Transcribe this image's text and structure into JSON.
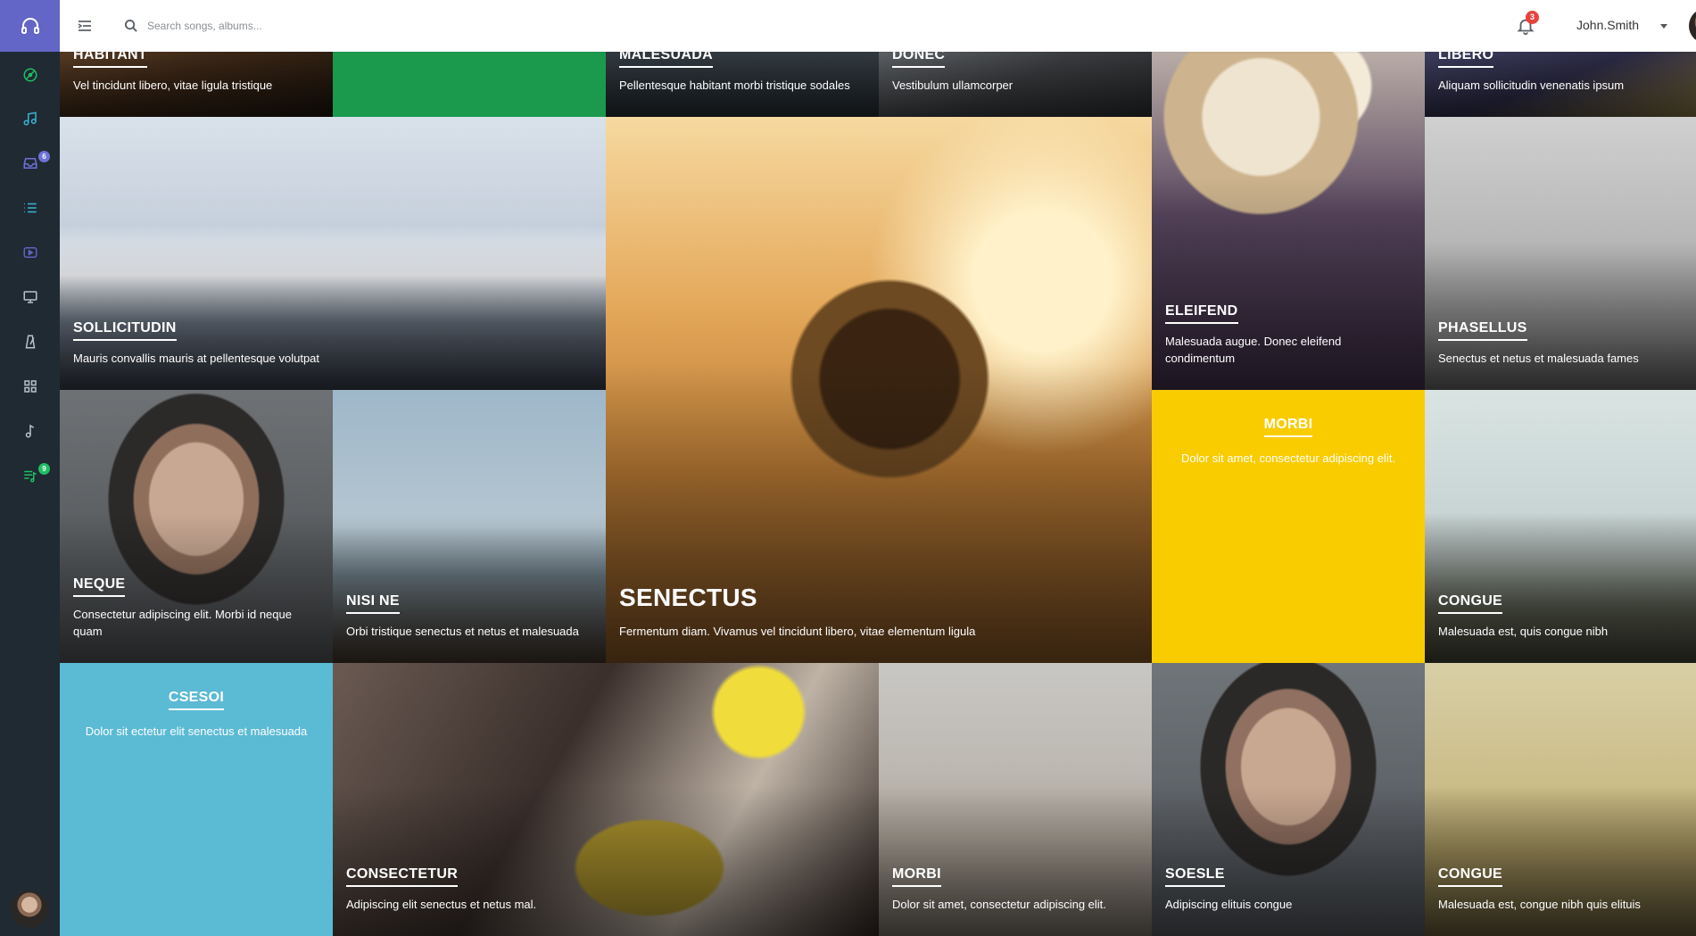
{
  "header": {
    "search_placeholder": "Search songs, albums...",
    "notifications_count": "3",
    "user_name": "John.Smith"
  },
  "sidebar": {
    "items": [
      {
        "icon": "headphones-icon"
      },
      {
        "icon": "disc-icon",
        "color": "#1fbf63"
      },
      {
        "icon": "music-note-icon",
        "color": "#39b4d8"
      },
      {
        "icon": "inbox-icon",
        "color": "#6e72d8",
        "badge": "6"
      },
      {
        "icon": "list-icon",
        "color": "#39b4d8"
      },
      {
        "icon": "video-icon",
        "color": "#5f63c2"
      },
      {
        "icon": "monitor-icon",
        "color": "#b8c2cc"
      },
      {
        "icon": "metronome-icon",
        "color": "#b8c2cc"
      },
      {
        "icon": "grid-icon",
        "color": "#b8c2cc"
      },
      {
        "icon": "eighth-note-icon",
        "color": "#b8c2cc"
      },
      {
        "icon": "playlist-icon",
        "color": "#1fbf63",
        "badge": "9"
      }
    ]
  },
  "tiles": {
    "habitant": {
      "title": "HABITANT",
      "desc": "Vel tincidunt libero, vitae ligula tristique"
    },
    "malesuada": {
      "title": "MALESUADA",
      "desc": "Pellentesque habitant morbi tristique sodales"
    },
    "donec": {
      "title": "DONEC",
      "desc": "Vestibulum ullamcorper"
    },
    "libero": {
      "title": "LIBERO",
      "desc": "Aliquam sollicitudin venenatis ipsum"
    },
    "sollicitudin": {
      "title": "SOLLICITUDIN",
      "desc": "Mauris convallis mauris at pellentesque volutpat"
    },
    "senectus": {
      "title": "SENECTUS",
      "desc": "Fermentum diam. Vivamus vel tincidunt libero, vitae elementum ligula"
    },
    "eleifend": {
      "title": "ELEIFEND",
      "desc": "Malesuada augue. Donec eleifend condimentum"
    },
    "phasellus": {
      "title": "PHASELLUS",
      "desc": "Senectus et netus et malesuada fames"
    },
    "neque": {
      "title": "NEQUE",
      "desc": "Consectetur adipiscing elit. Morbi id neque quam"
    },
    "nisi_ne": {
      "title": "NISI NE",
      "desc": "Orbi tristique senectus et netus et malesuada"
    },
    "morbi_yellow": {
      "title": "MORBI",
      "desc": "Dolor sit amet, consectetur adipiscing elit."
    },
    "congue_1": {
      "title": "CONGUE",
      "desc": "Malesuada est, quis congue nibh"
    },
    "csesoi": {
      "title": "CSESOI",
      "desc": "Dolor sit ectetur elit senectus et malesuada"
    },
    "consectetur": {
      "title": "CONSECTETUR",
      "desc": "Adipiscing elit senectus et netus mal."
    },
    "morbi_dunes": {
      "title": "MORBI",
      "desc": "Dolor sit amet, consectetur adipiscing elit."
    },
    "soesle": {
      "title": "SOESLE",
      "desc": "Adipiscing elituis congue"
    },
    "congue_2": {
      "title": "CONGUE",
      "desc": "Malesuada est, congue nibh quis elituis"
    }
  },
  "colors": {
    "brand": "#6366c7",
    "sidebar_bg": "#1f2a33",
    "tile_green": "#1b9a4d",
    "tile_yellow": "#f9cc00",
    "tile_blue": "#5bbad4",
    "badge_red": "#e8423f"
  }
}
